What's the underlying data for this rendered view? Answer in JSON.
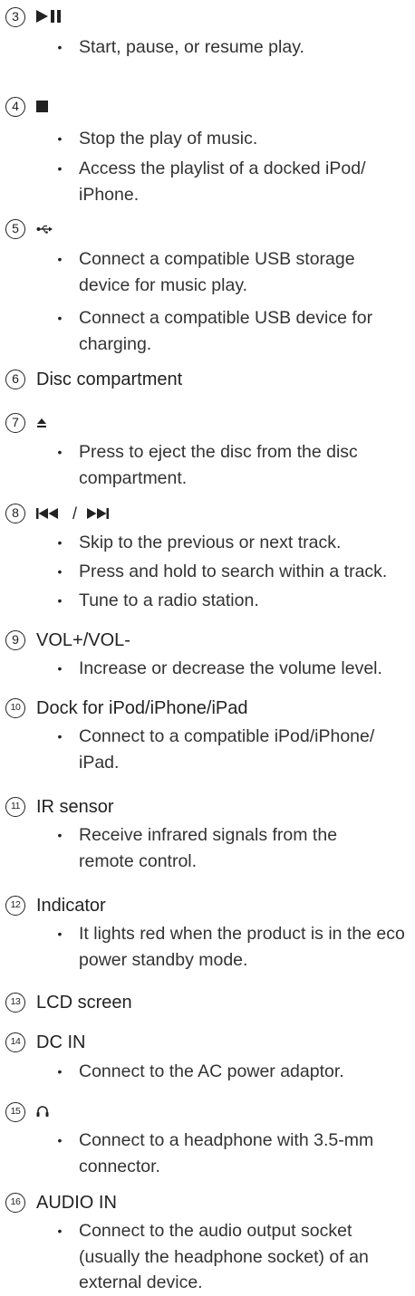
{
  "items": [
    {
      "num": "3",
      "icon": "play-pause-icon",
      "bullets": [
        "Start, pause, or resume play."
      ]
    },
    {
      "num": "4",
      "icon": "stop-icon",
      "bullets": [
        "Stop the play of music.",
        "Access the playlist of a docked iPod/ iPhone."
      ]
    },
    {
      "num": "5",
      "icon": "usb-icon",
      "bullets": [
        "Connect a compatible USB storage device for music play.",
        "Connect a compatible USB device for charging."
      ]
    },
    {
      "num": "6",
      "title": "Disc compartment"
    },
    {
      "num": "7",
      "icon": "eject-icon",
      "bullets": [
        "Press to eject the disc from the disc compartment."
      ]
    },
    {
      "num": "8",
      "icon": "previous-next-icon",
      "slash": "/",
      "bullets": [
        "Skip to the previous or next track.",
        "Press and hold to search within a track.",
        "Tune to a radio station."
      ]
    },
    {
      "num": "9",
      "title": "VOL+/VOL-",
      "bullets": [
        "Increase or decrease the volume level."
      ]
    },
    {
      "num": "10",
      "title": "Dock for iPod/iPhone/iPad",
      "bullets": [
        "Connect to a compatible iPod/iPhone/ iPad."
      ]
    },
    {
      "num": "11",
      "title": "IR sensor",
      "bullets": [
        "Receive infrared signals from the remote control."
      ]
    },
    {
      "num": "12",
      "title": "Indicator",
      "bullets": [
        "It lights red when the product is in the eco power standby mode."
      ]
    },
    {
      "num": "13",
      "title": "LCD screen"
    },
    {
      "num": "14",
      "title": "DC IN",
      "bullets": [
        "Connect to the AC power adaptor."
      ]
    },
    {
      "num": "15",
      "icon": "headphone-icon",
      "bullets": [
        "Connect to a headphone with 3.5-mm connector."
      ]
    },
    {
      "num": "16",
      "title": "AUDIO IN",
      "bullets": [
        "Connect to the audio output socket (usually the headphone socket) of an external device."
      ]
    }
  ]
}
